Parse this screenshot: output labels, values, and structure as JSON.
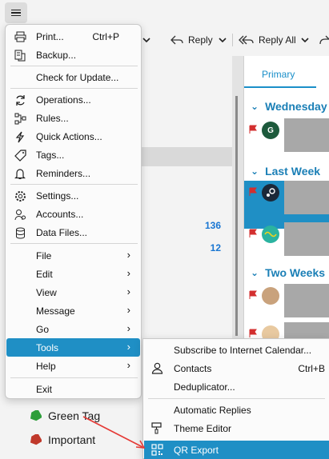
{
  "toolbar": {
    "reply_label": "Reply",
    "reply_all_label": "Reply All"
  },
  "sidebar": {
    "counts": [
      "136",
      "12"
    ],
    "tags": [
      {
        "label": "Green Tag",
        "color": "#2e9e3a"
      },
      {
        "label": "Important",
        "color": "#c0392b"
      }
    ]
  },
  "maillist": {
    "tab": "Primary",
    "groups": [
      "Wednesday",
      "Last Week",
      "Two Weeks"
    ],
    "avatar_g": "G"
  },
  "menu": {
    "print": {
      "label": "Print...",
      "shortcut": "Ctrl+P"
    },
    "backup": {
      "label": "Backup..."
    },
    "check_update": {
      "label": "Check for Update..."
    },
    "operations": {
      "label": "Operations..."
    },
    "rules": {
      "label": "Rules..."
    },
    "quick_actions": {
      "label": "Quick Actions..."
    },
    "tags": {
      "label": "Tags..."
    },
    "reminders": {
      "label": "Reminders..."
    },
    "settings": {
      "label": "Settings..."
    },
    "accounts": {
      "label": "Accounts..."
    },
    "data_files": {
      "label": "Data Files..."
    },
    "file": {
      "label": "File"
    },
    "edit": {
      "label": "Edit"
    },
    "view": {
      "label": "View"
    },
    "message": {
      "label": "Message"
    },
    "go": {
      "label": "Go"
    },
    "tools": {
      "label": "Tools"
    },
    "help": {
      "label": "Help"
    },
    "exit": {
      "label": "Exit"
    }
  },
  "submenu": {
    "subscribe": {
      "label": "Subscribe to Internet Calendar..."
    },
    "contacts": {
      "label": "Contacts",
      "shortcut": "Ctrl+B"
    },
    "deduplicator": {
      "label": "Deduplicator..."
    },
    "auto_replies": {
      "label": "Automatic Replies"
    },
    "theme_editor": {
      "label": "Theme Editor"
    },
    "qr_export": {
      "label": "QR Export"
    }
  },
  "colors": {
    "accent": "#1f8fc5",
    "link_blue": "#1976d2",
    "flag_red": "#d32f2f"
  }
}
